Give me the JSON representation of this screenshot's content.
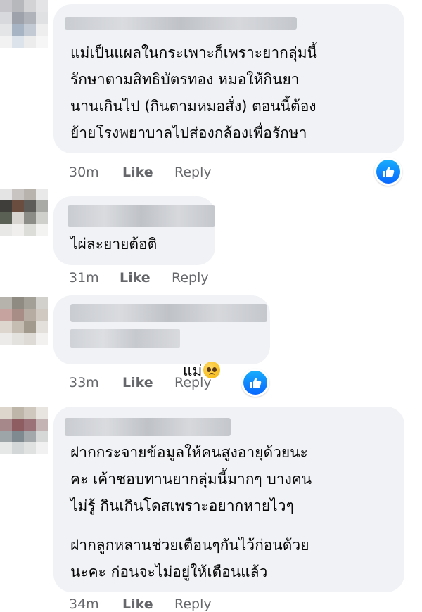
{
  "comments": [
    {
      "text": "แม่เป็นแผลในกระเพาะก็เพราะยากลุ่มนี้\nรักษาตามสิทธิบัตรทอง หมอให้กินยา\nนานเกินไป (กินตามหมอสั่ง) ตอนนี้ต้อง\nย้ายโรงพยาบาลไปส่องกล้องเพื่อรักษา",
      "time": "30m",
      "like": "Like",
      "reply": "Reply",
      "reaction": "like-icon"
    },
    {
      "text": "ไผ่ละยายต้อติ",
      "time": "31m",
      "like": "Like",
      "reply": "Reply"
    },
    {
      "text": "แม่",
      "emoji": "pleading-face-icon",
      "time": "33m",
      "like": "Like",
      "reply": "Reply",
      "reaction": "like-icon"
    },
    {
      "text_p1": "ฝากกระจายข้อมูลให้คนสูงอายุด้วยนะ\nคะ เค้าชอบทานยากลุ่มนี้มากๆ บางคน\nไม่รู้ กินเกินโดสเพราะอยากหายไวๆ",
      "text_p2": "ฝากลูกหลานช่วยเตือนๆกันไว้ก่อนด้วย\nนะคะ ก่อนจะไม่อยู่ให้เตือนแล้ว",
      "time": "34m",
      "like": "Like",
      "reply": "Reply"
    }
  ],
  "colors": {
    "bubble": "#f0f2f5",
    "meta": "#65676b",
    "accent": "#0866ff"
  }
}
